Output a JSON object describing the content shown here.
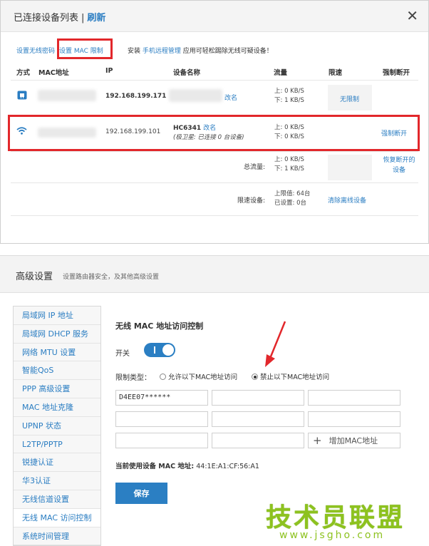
{
  "connected": {
    "title": "已连接设备列表",
    "separator": "|",
    "refresh": "刷新",
    "close": "✕",
    "toolbar": {
      "wifi_password": "设置无线密码",
      "mac_limit": "设置 MAC 限制",
      "tip_prefix": "安装",
      "tip_link": "手机远程管理",
      "tip_suffix": "应用可轻松踢除无线可疑设备！"
    },
    "columns": [
      "方式",
      "MAC地址",
      "IP",
      "设备名称",
      "流量",
      "限速",
      "强制断开"
    ],
    "devices": [
      {
        "connection_icon": "lan-icon",
        "ip": "192.168.199.171",
        "rename": "改名",
        "up": "上: 0 KB/S",
        "down": "下: 1 KB/S",
        "limit": "无限制"
      },
      {
        "connection_icon": "wifi-icon",
        "ip": "192.168.199.101",
        "name": "HC6341",
        "rename": "改名",
        "extra": "(极卫星: 已连接 0 台设备)",
        "up": "上: 0 KB/S",
        "down": "下: 0 KB/S",
        "disconnect": "强制断开"
      }
    ],
    "total": {
      "label": "总流量:",
      "up": "上: 0 KB/S",
      "down": "下: 1 KB/S",
      "restore": "恢复断开的设备"
    },
    "limited": {
      "label": "限速设备:",
      "max": "上限值: 64台",
      "set": "已设置: 0台",
      "clear": "清除离线设备"
    }
  },
  "advanced": {
    "title": "高级设置",
    "subtitle": "设置路由器安全，及其他高级设置",
    "menu": [
      "局域网 IP 地址",
      "局域网 DHCP 服务",
      "网络 MTU 设置",
      "智能QoS",
      "PPP 高级设置",
      "MAC 地址克隆",
      "UPNP 状态",
      "L2TP/PPTP",
      "锐捷认证",
      "华3认证",
      "无线信道设置",
      "无线 MAC 访问控制",
      "系统时间管理"
    ],
    "active_menu": 11,
    "section_title": "无线 MAC 地址访问控制",
    "switch_label": "开关",
    "switch_on": true,
    "restrict_label": "限制类型：",
    "option_allow": "允许以下MAC地址访问",
    "option_deny": "禁止以下MAC地址访问",
    "selected_option": "deny",
    "mac_entries": [
      "D4EE07******",
      "",
      "",
      "",
      "",
      "",
      "",
      ""
    ],
    "add_mac": "增加MAC地址",
    "current_mac_label": "当前使用设备 MAC 地址:",
    "current_mac_value": "44:1E:A1:CF:56:A1",
    "save": "保存"
  },
  "watermark": {
    "text": "技术员联盟",
    "url": "www.jsgho.com"
  },
  "colors": {
    "accent": "#2b7fc3",
    "link": "#2a7dc2",
    "highlight": "#e2272b",
    "watermark": "#8dc21f"
  }
}
